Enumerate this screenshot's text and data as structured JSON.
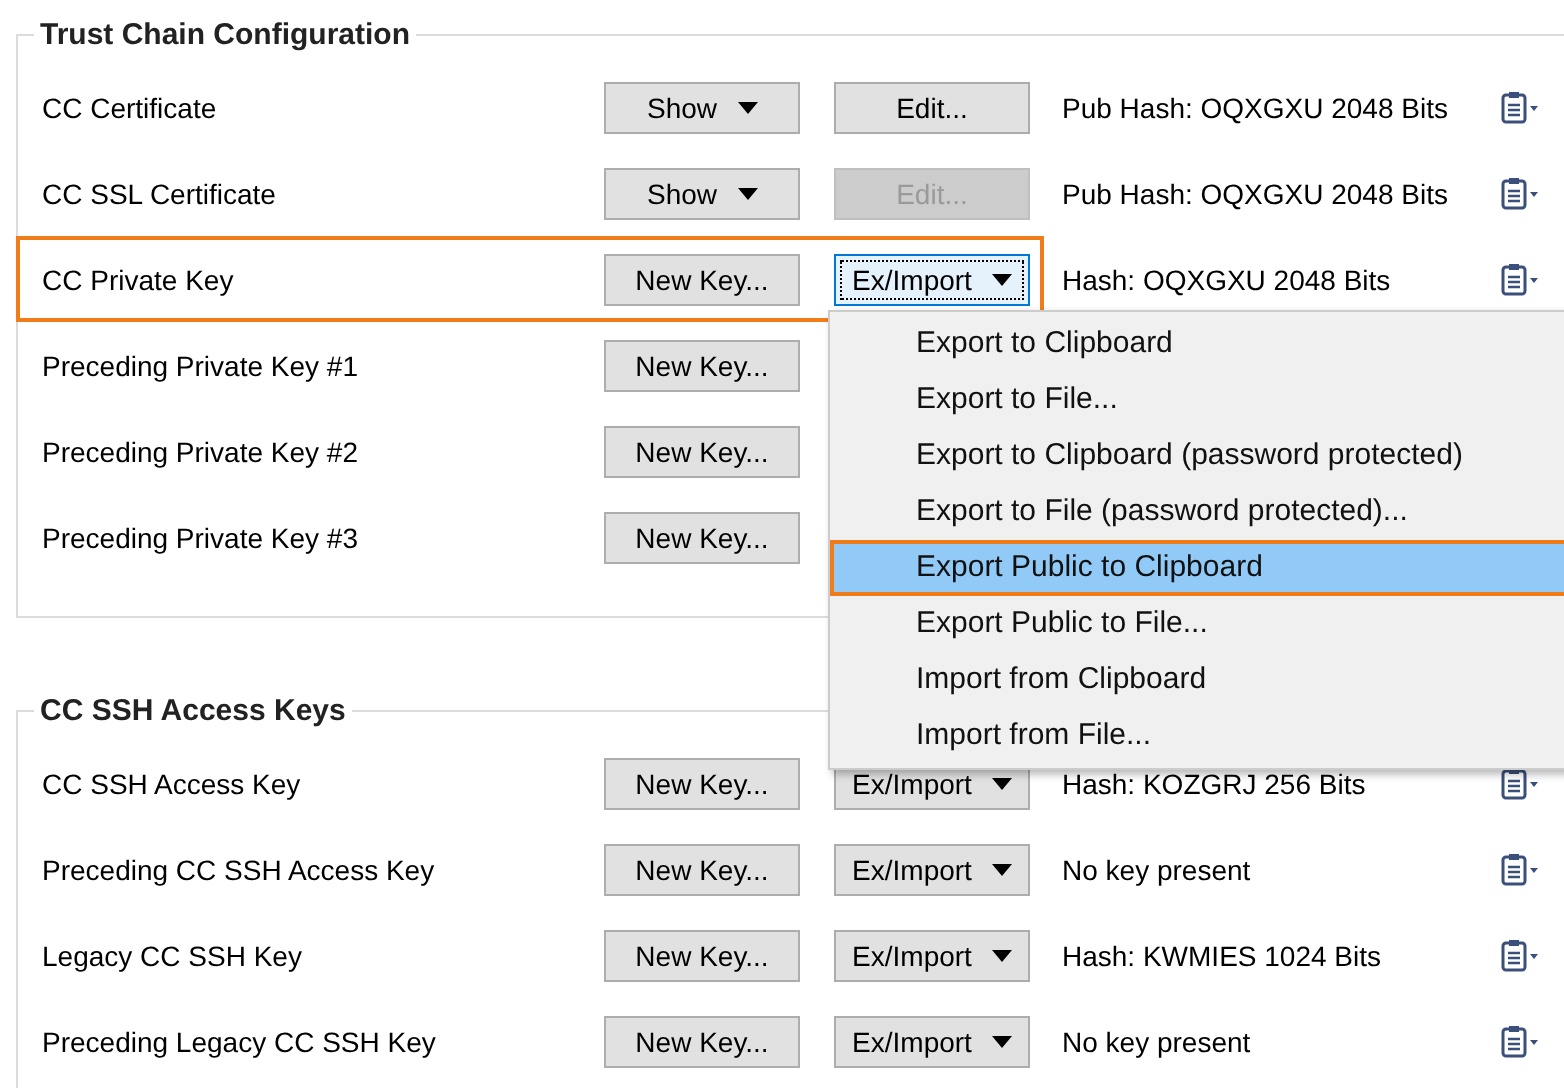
{
  "groups": [
    {
      "title": "Trust Chain Configuration",
      "rows": [
        {
          "label": "CC Certificate",
          "highlighted": false,
          "buttons": [
            {
              "label": "Show",
              "kind": "dropdown",
              "disabled": false,
              "focused": false
            },
            {
              "label": "Edit...",
              "kind": "plain",
              "disabled": false,
              "focused": false
            }
          ],
          "info": "Pub Hash: OQXGXU 2048 Bits"
        },
        {
          "label": "CC SSL Certificate",
          "highlighted": false,
          "buttons": [
            {
              "label": "Show",
              "kind": "dropdown",
              "disabled": false,
              "focused": false
            },
            {
              "label": "Edit...",
              "kind": "plain",
              "disabled": true,
              "focused": false
            }
          ],
          "info": "Pub Hash: OQXGXU 2048 Bits"
        },
        {
          "label": "CC Private Key",
          "highlighted": true,
          "buttons": [
            {
              "label": "New Key...",
              "kind": "plain",
              "disabled": false,
              "focused": false
            },
            {
              "label": "Ex/Import",
              "kind": "dropdown",
              "disabled": false,
              "focused": true
            }
          ],
          "info": "Hash: OQXGXU 2048 Bits"
        },
        {
          "label": "Preceding Private Key #1",
          "highlighted": false,
          "buttons": [
            {
              "label": "New Key...",
              "kind": "plain",
              "disabled": false,
              "focused": false
            }
          ]
        },
        {
          "label": "Preceding Private Key #2",
          "highlighted": false,
          "buttons": [
            {
              "label": "New Key...",
              "kind": "plain",
              "disabled": false,
              "focused": false
            }
          ]
        },
        {
          "label": "Preceding Private Key #3",
          "highlighted": false,
          "buttons": [
            {
              "label": "New Key...",
              "kind": "plain",
              "disabled": false,
              "focused": false
            }
          ]
        }
      ]
    },
    {
      "title": "CC SSH Access Keys",
      "rows": [
        {
          "label": "CC SSH Access Key",
          "highlighted": false,
          "buttons": [
            {
              "label": "New Key...",
              "kind": "plain",
              "disabled": false,
              "focused": false
            },
            {
              "label": "Ex/Import",
              "kind": "dropdown",
              "disabled": false,
              "focused": false
            }
          ],
          "info": "Hash: KOZGRJ 256 Bits"
        },
        {
          "label": "Preceding CC SSH Access Key",
          "highlighted": false,
          "buttons": [
            {
              "label": "New Key...",
              "kind": "plain",
              "disabled": false,
              "focused": false
            },
            {
              "label": "Ex/Import",
              "kind": "dropdown",
              "disabled": false,
              "focused": false
            }
          ],
          "info": "No key present"
        },
        {
          "label": "Legacy CC SSH Key",
          "highlighted": false,
          "buttons": [
            {
              "label": "New Key...",
              "kind": "plain",
              "disabled": false,
              "focused": false
            },
            {
              "label": "Ex/Import",
              "kind": "dropdown",
              "disabled": false,
              "focused": false
            }
          ],
          "info": "Hash: KWMIES 1024 Bits"
        },
        {
          "label": "Preceding Legacy CC SSH Key",
          "highlighted": false,
          "buttons": [
            {
              "label": "New Key...",
              "kind": "plain",
              "disabled": false,
              "focused": false
            },
            {
              "label": "Ex/Import",
              "kind": "dropdown",
              "disabled": false,
              "focused": false
            }
          ],
          "info": "No key present"
        }
      ]
    }
  ],
  "menu": {
    "items": [
      {
        "label": "Export to Clipboard",
        "selected": false
      },
      {
        "label": "Export to File...",
        "selected": false
      },
      {
        "label": "Export to Clipboard (password protected)",
        "selected": false
      },
      {
        "label": "Export to File (password protected)...",
        "selected": false
      },
      {
        "label": "Export Public to Clipboard",
        "selected": true
      },
      {
        "label": "Export Public to File...",
        "selected": false
      },
      {
        "label": "Import from Clipboard",
        "selected": false
      },
      {
        "label": "Import from File...",
        "selected": false
      }
    ]
  }
}
